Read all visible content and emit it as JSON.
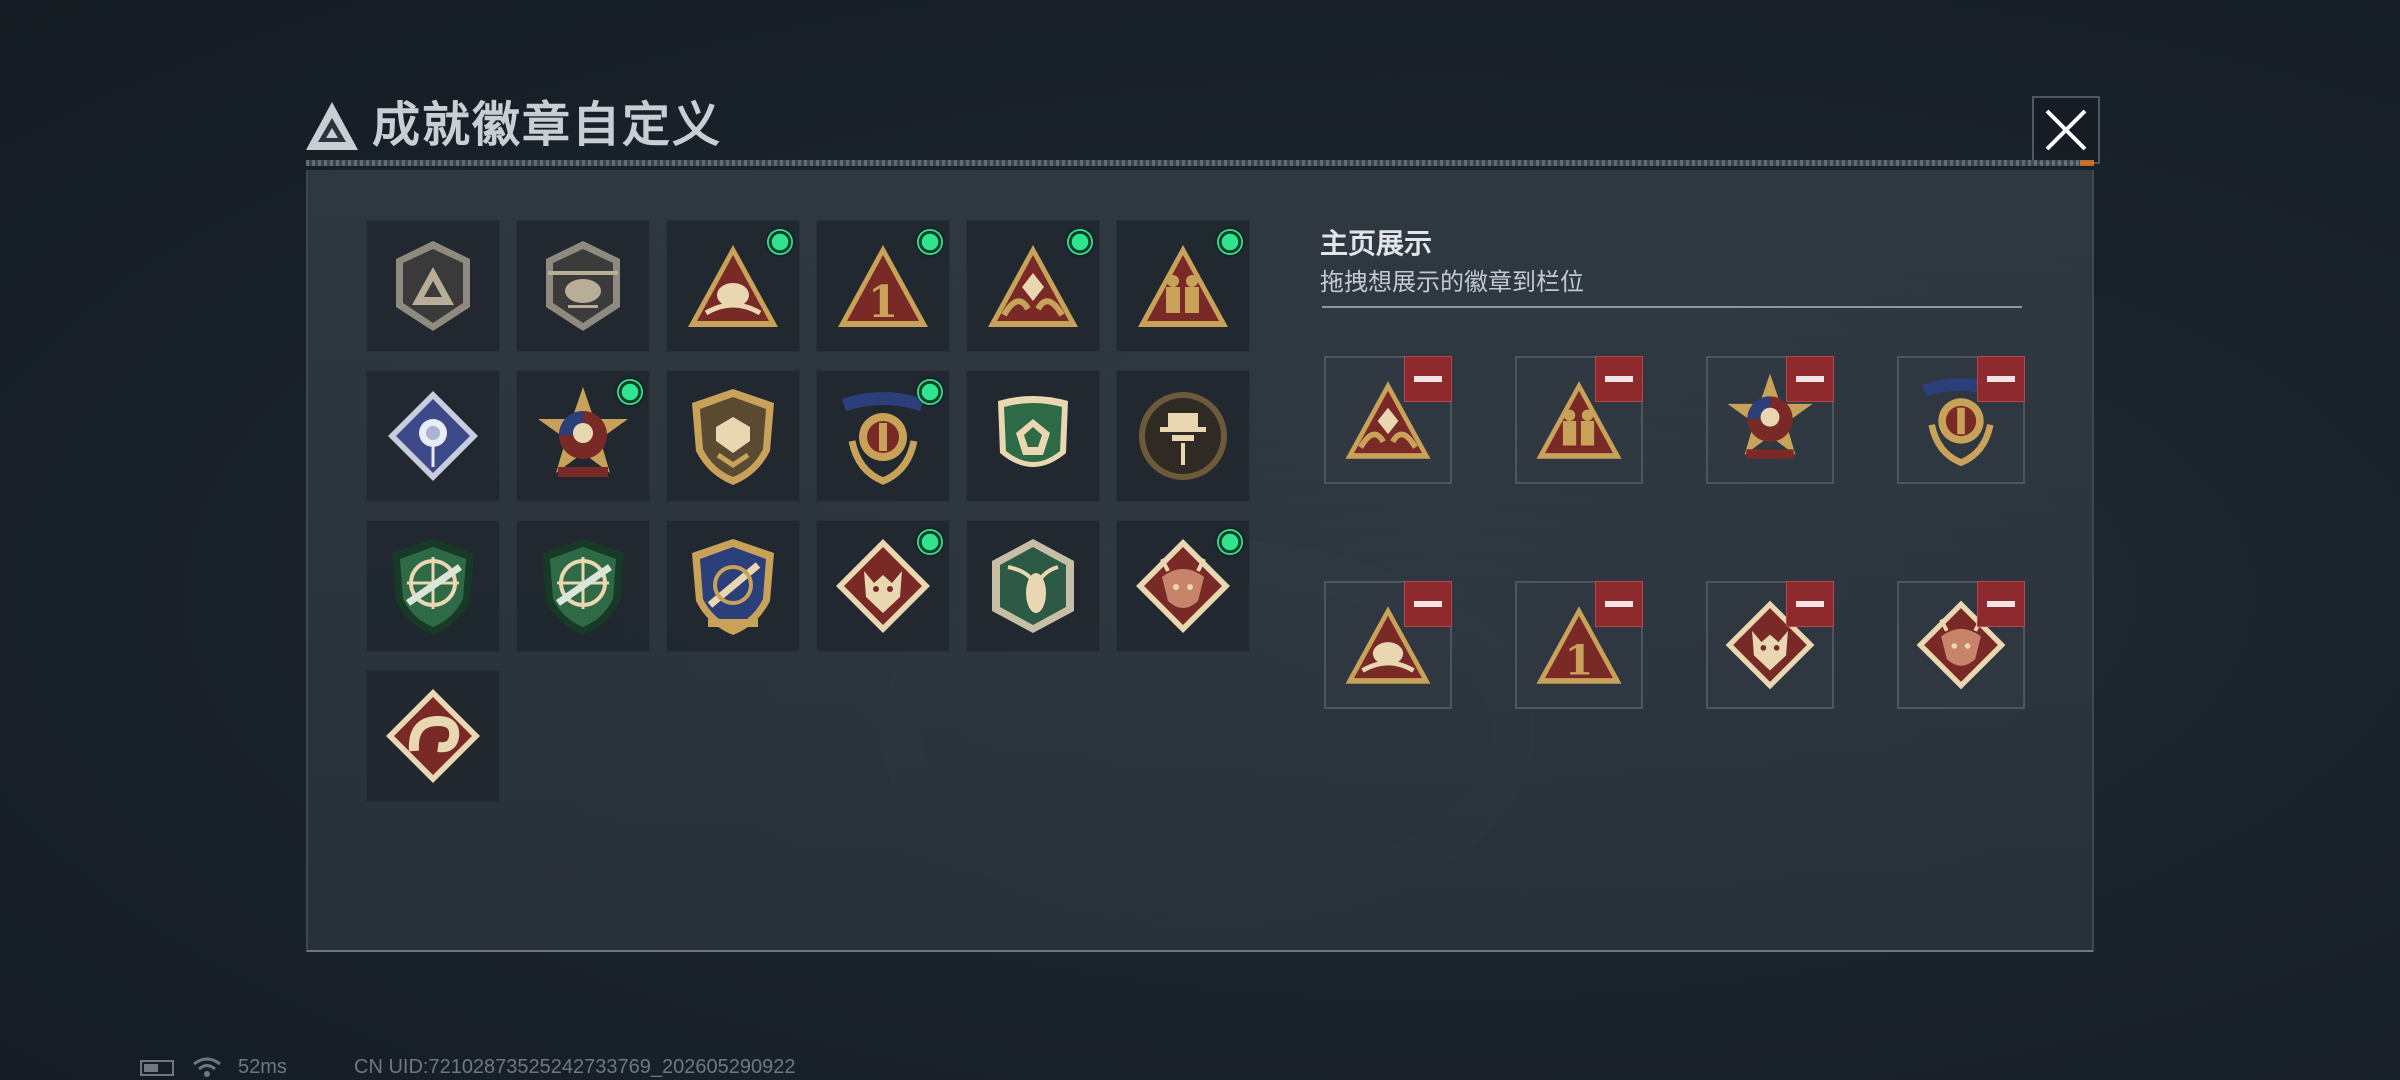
{
  "header": {
    "title": "成就徽章自定义",
    "close_icon": "close-icon"
  },
  "badges": [
    {
      "icon": "triangle-logo-shield-badge",
      "new": false
    },
    {
      "icon": "helicopter-shield-badge",
      "new": false
    },
    {
      "icon": "gold-triangle-plant-badge",
      "new": true
    },
    {
      "icon": "gold-triangle-number-1-badge",
      "new": true
    },
    {
      "icon": "gold-triangle-hands-dice-badge",
      "new": true
    },
    {
      "icon": "gold-triangle-soldiers-badge",
      "new": true
    },
    {
      "icon": "blue-diamond-rose-badge",
      "new": false
    },
    {
      "icon": "star-medal-skull-badge",
      "new": true
    },
    {
      "icon": "gold-shield-emblem-badge",
      "new": false
    },
    {
      "icon": "laurel-crest-stars-badge",
      "new": true
    },
    {
      "icon": "green-shield-dice-badge",
      "new": false
    },
    {
      "icon": "round-agent-hat-badge",
      "new": false
    },
    {
      "icon": "green-shield-rifle-crosshair-badge",
      "new": false
    },
    {
      "icon": "green-shield-rifle-crosshair-badge-2",
      "new": false
    },
    {
      "icon": "gold-blue-shield-pen-badge",
      "new": false
    },
    {
      "icon": "red-diamond-wolf-badge",
      "new": true
    },
    {
      "icon": "green-hexagon-wasp-badge",
      "new": false
    },
    {
      "icon": "red-diamond-dragon-badge",
      "new": true
    },
    {
      "icon": "red-diamond-snake-badge",
      "new": false
    }
  ],
  "display": {
    "title": "主页展示",
    "subtitle": "拖拽想展示的徽章到栏位",
    "slots": [
      {
        "icon": "gold-triangle-hands-dice-badge"
      },
      {
        "icon": "gold-triangle-soldiers-badge"
      },
      {
        "icon": "star-medal-skull-badge"
      },
      {
        "icon": "laurel-crest-stars-badge"
      },
      {
        "icon": "gold-triangle-plant-badge"
      },
      {
        "icon": "gold-triangle-number-1-badge"
      },
      {
        "icon": "red-diamond-wolf-badge"
      },
      {
        "icon": "red-diamond-dragon-badge"
      }
    ]
  },
  "status_bar": {
    "ping": "52ms",
    "uid": "CN UID:7210287352524273376​9_202605290922"
  },
  "colors": {
    "panel": "#333c45",
    "gold": "#c9a25a",
    "new_dot": "#2fe38f",
    "remove_red": "#8e2a2e"
  }
}
